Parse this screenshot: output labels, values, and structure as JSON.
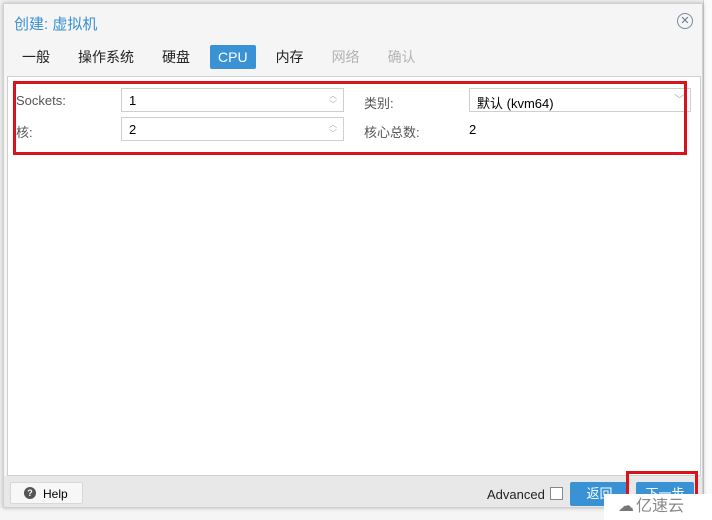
{
  "window": {
    "title": "创建: 虚拟机",
    "close_icon": "circle-x-icon"
  },
  "tabs": [
    {
      "label": "一般",
      "state": "normal"
    },
    {
      "label": "操作系统",
      "state": "normal"
    },
    {
      "label": "硬盘",
      "state": "normal"
    },
    {
      "label": "CPU",
      "state": "active"
    },
    {
      "label": "内存",
      "state": "normal"
    },
    {
      "label": "网络",
      "state": "disabled"
    },
    {
      "label": "确认",
      "state": "disabled"
    }
  ],
  "form": {
    "sockets": {
      "label": "Sockets:",
      "value": "1"
    },
    "cores": {
      "label": "核:",
      "value": "2"
    },
    "type": {
      "label": "类别:",
      "value": "默认 (kvm64)"
    },
    "total_cores": {
      "label": "核心总数:",
      "value": "2"
    }
  },
  "footer": {
    "help_label": "Help",
    "help_icon": "question-circle-icon",
    "advanced_label": "Advanced",
    "advanced_checked": false,
    "back_label": "返回",
    "next_label": "下一步"
  },
  "watermark": {
    "text": "亿速云",
    "icon": "cloud-logo-icon"
  },
  "colors": {
    "accent": "#3892d3",
    "highlight_box": "#d9131b",
    "title": "#3a8fd0"
  }
}
